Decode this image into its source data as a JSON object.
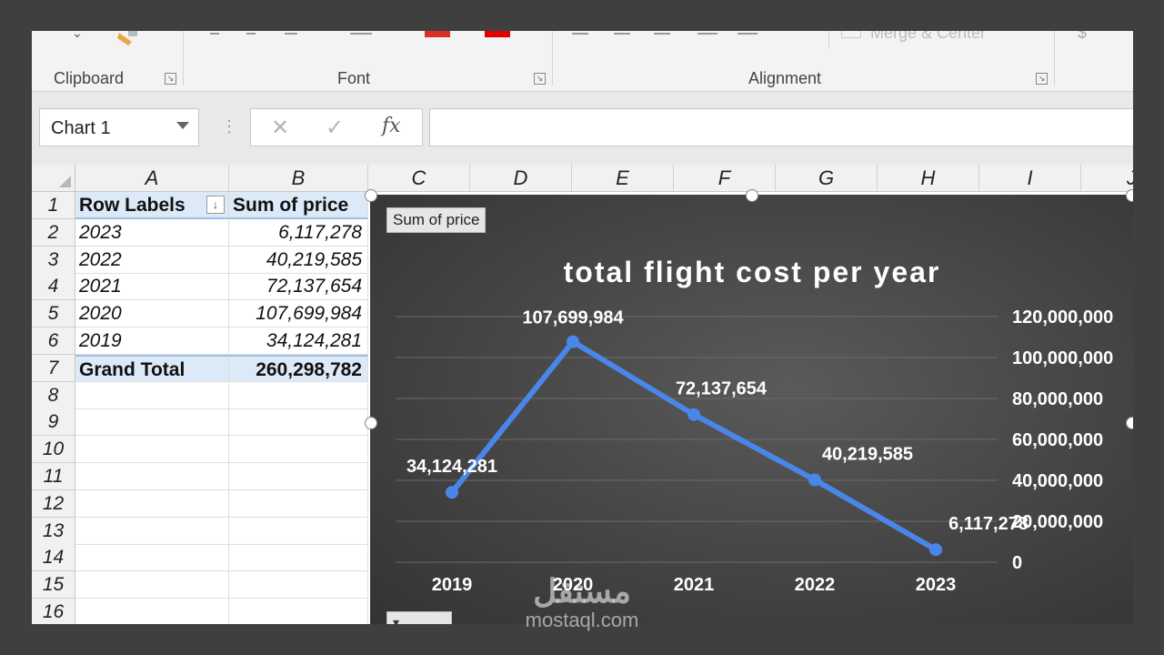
{
  "ribbon": {
    "groups": [
      {
        "label": "Clipboard"
      },
      {
        "label": "Font"
      },
      {
        "label": "Alignment"
      }
    ],
    "faded_command": "Merge & Center"
  },
  "formula_bar": {
    "name_box": "Chart 1",
    "cancel_glyph": "✕",
    "enter_glyph": "✓",
    "fx_glyph": "fx",
    "formula": ""
  },
  "sheet": {
    "columns": [
      "A",
      "B",
      "C",
      "D",
      "E",
      "F",
      "G",
      "H",
      "I",
      "J"
    ],
    "rows": [
      "1",
      "2",
      "3",
      "4",
      "5",
      "6",
      "7",
      "8",
      "9",
      "10",
      "11",
      "12",
      "13",
      "14",
      "15",
      "16"
    ],
    "pivot": {
      "header_labels": "Row Labels",
      "header_value": "Sum of price",
      "filter_glyph": "↓",
      "rows": [
        {
          "label": "2023",
          "value": "6,117,278"
        },
        {
          "label": "2022",
          "value": "40,219,585"
        },
        {
          "label": "2021",
          "value": "72,137,654"
        },
        {
          "label": "2020",
          "value": "107,699,984"
        },
        {
          "label": "2019",
          "value": "34,124,281"
        }
      ],
      "total_label": "Grand Total",
      "total_value": "260,298,782"
    }
  },
  "chart_field_button": "Sum of price",
  "chart_data": {
    "type": "line",
    "title": "total flight cost per year",
    "categories": [
      "2019",
      "2020",
      "2021",
      "2022",
      "2023"
    ],
    "series": [
      {
        "values": [
          34124281,
          107699984,
          72137654,
          40219585,
          6117278
        ],
        "labels": [
          "34,124,281",
          "107,699,984",
          "72,137,654",
          "40,219,585",
          "6,117,278"
        ]
      }
    ],
    "ylim": [
      0,
      120000000
    ],
    "yticks": [
      "0",
      "20,000,000",
      "40,000,000",
      "60,000,000",
      "80,000,000",
      "100,000,000",
      "120,000,000"
    ],
    "y_axis_side": "right",
    "grid": true,
    "legend": "none",
    "colors": {
      "line": "#4a86e8",
      "text": "#ffffff",
      "grid": "#6a6a6a"
    }
  },
  "watermark": {
    "arabic": "مستقل",
    "latin": "mostaql.com"
  }
}
